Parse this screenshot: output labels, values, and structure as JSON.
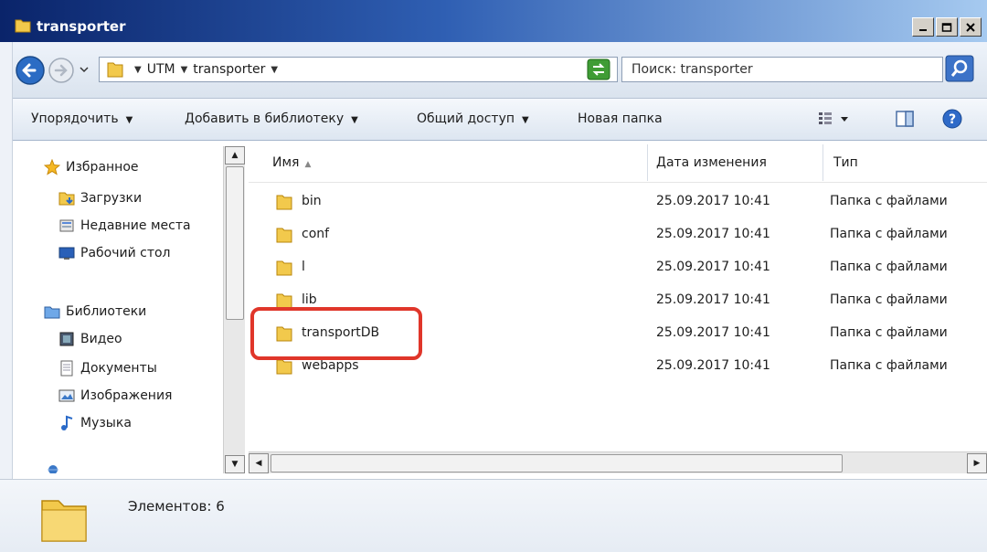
{
  "window": {
    "title": "transporter"
  },
  "address": {
    "breadcrumb": [
      "UTM",
      "transporter"
    ],
    "search_placeholder": "Поиск: transporter"
  },
  "toolbar": {
    "organize": "Упорядочить",
    "add_to_library": "Добавить в библиотеку",
    "share": "Общий доступ",
    "new_folder": "Новая папка"
  },
  "sidebar": {
    "favorites": "Избранное",
    "downloads": "Загрузки",
    "recent": "Недавние места",
    "desktop": "Рабочий стол",
    "libraries": "Библиотеки",
    "video": "Видео",
    "documents": "Документы",
    "images": "Изображения",
    "music": "Музыка"
  },
  "columns": {
    "name": "Имя",
    "date": "Дата изменения",
    "type": "Тип"
  },
  "files": [
    {
      "name": "bin",
      "date": "25.09.2017 10:41",
      "type": "Папка с файлами"
    },
    {
      "name": "conf",
      "date": "25.09.2017 10:41",
      "type": "Папка с файлами"
    },
    {
      "name": "l",
      "date": "25.09.2017 10:41",
      "type": "Папка с файлами"
    },
    {
      "name": "lib",
      "date": "25.09.2017 10:41",
      "type": "Папка с файлами"
    },
    {
      "name": "transportDB",
      "date": "25.09.2017 10:41",
      "type": "Папка с файлами"
    },
    {
      "name": "webapps",
      "date": "25.09.2017 10:41",
      "type": "Папка с файлами"
    }
  ],
  "status": {
    "items": "Элементов: 6"
  },
  "colors": {
    "highlight": "#e0362a",
    "titlebar": "#0a246a"
  }
}
